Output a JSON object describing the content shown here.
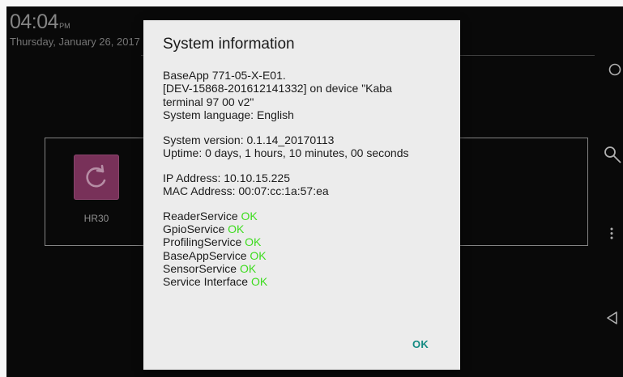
{
  "status": {
    "time": "04:04",
    "ampm": "PM",
    "date": "Thursday, January 26, 2017"
  },
  "apps": [
    {
      "label": "HR30",
      "icon": "refresh-icon",
      "tile_color": "#8e3a69"
    }
  ],
  "navbar": {
    "items": [
      {
        "icon": "home-circle-icon"
      },
      {
        "icon": "search-icon"
      },
      {
        "icon": "more-vert-icon"
      },
      {
        "icon": "back-triangle-icon"
      }
    ]
  },
  "dialog": {
    "title": "System information",
    "app_line": "BaseApp 771-05-X-E01.",
    "device_line1": "[DEV-15868-201612141332] on device \"Kaba",
    "device_line2": "terminal 97 00 v2\"",
    "language_line": "System language: English",
    "version_line": "System version: 0.1.14_20170113",
    "uptime_line": "Uptime: 0 days, 1 hours, 10 minutes, 00 seconds",
    "ip_line": "IP Address: 10.10.15.225",
    "mac_line": "MAC Address: 00:07:cc:1a:57:ea",
    "services": [
      {
        "name": "ReaderService",
        "status": "OK"
      },
      {
        "name": "GpioService",
        "status": "OK"
      },
      {
        "name": "ProfilingService",
        "status": "OK"
      },
      {
        "name": "BaseAppService",
        "status": "OK"
      },
      {
        "name": "SensorService",
        "status": "OK"
      },
      {
        "name": "Service Interface",
        "status": "OK"
      }
    ],
    "ok_label": "OK"
  },
  "colors": {
    "service_ok": "#3ddc1e",
    "dialog_button": "#138a82",
    "dialog_bg": "#ececec"
  }
}
